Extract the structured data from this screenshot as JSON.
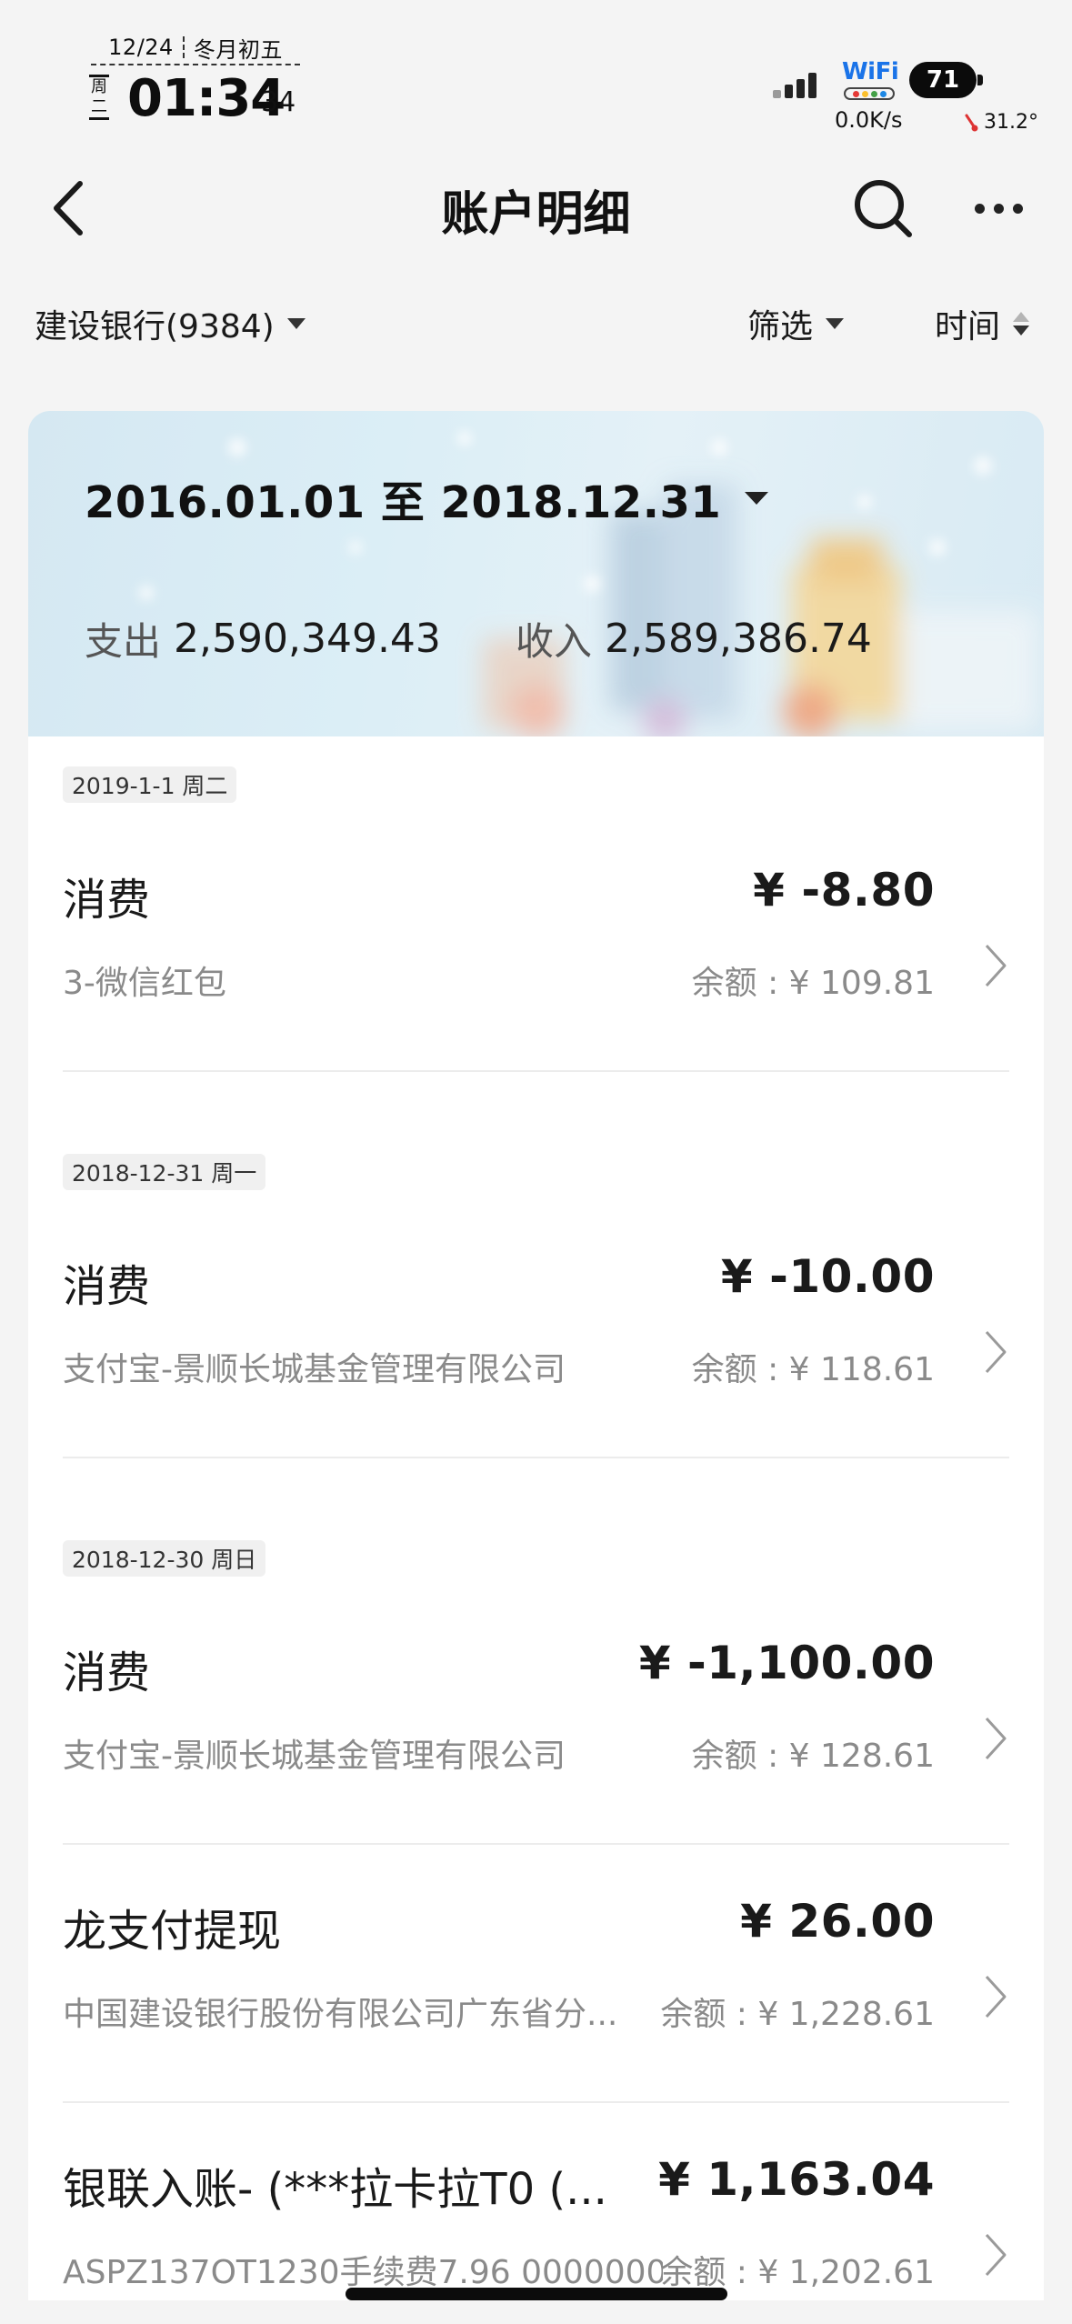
{
  "status_bar": {
    "date": "12/24",
    "lunar": "冬月初五",
    "weekday": "周二",
    "time": "01:34",
    "seconds": "34",
    "wifi_label": "WiFi",
    "battery": "71",
    "net_speed": "0.0K/s",
    "temperature": "31.2°"
  },
  "nav": {
    "title": "账户明细",
    "back_icon": "chevron-left-icon",
    "search_icon": "search-icon",
    "more_icon": "more-horizontal-icon"
  },
  "filters": {
    "account": "建设银行(9384)",
    "filter": "筛选",
    "sort": "时间"
  },
  "summary": {
    "date_range": "2016.01.01 至 2018.12.31",
    "expense_label": "支出",
    "expense_value": "2,590,349.43",
    "income_label": "收入",
    "income_value": "2,589,386.74"
  },
  "groups": [
    {
      "date": "2019-1-1 周二",
      "transactions": [
        {
          "title": "消费",
          "amount": "¥ -8.80",
          "desc": "3-微信红包",
          "balance": "余额 : ¥ 109.81"
        }
      ]
    },
    {
      "date": "2018-12-31 周一",
      "transactions": [
        {
          "title": "消费",
          "amount": "¥ -10.00",
          "desc": "支付宝-景顺长城基金管理有限公司",
          "balance": "余额 : ¥ 118.61"
        }
      ]
    },
    {
      "date": "2018-12-30 周日",
      "transactions": [
        {
          "title": "消费",
          "amount": "¥ -1,100.00",
          "desc": "支付宝-景顺长城基金管理有限公司",
          "balance": "余额 : ¥ 128.61"
        },
        {
          "title": "龙支付提现",
          "amount": "¥ 26.00",
          "desc": "中国建设银行股份有限公司广东省分...",
          "balance": "余额 : ¥ 1,228.61"
        },
        {
          "title": "银联入账- (***拉卡拉T0 (...",
          "amount": "¥ 1,163.04",
          "desc": "ASPZ137OT1230手续费7.96 0000000...",
          "balance": "余额 : ¥ 1,202.61"
        }
      ]
    }
  ],
  "colors": {
    "background": "#f4f4f4",
    "card": "#ffffff",
    "text_primary": "#1a1a1a",
    "text_secondary": "#8a8a8a",
    "summary_gradient": "#dbeef6"
  }
}
